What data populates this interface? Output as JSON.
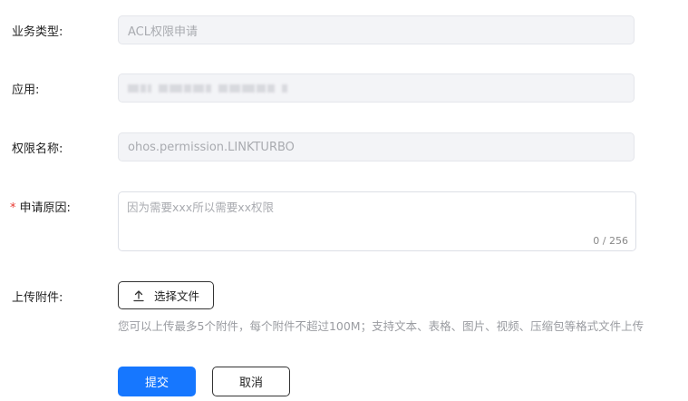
{
  "form": {
    "business_type": {
      "label": "业务类型:",
      "value": "ACL权限申请"
    },
    "application": {
      "label": "应用:"
    },
    "permission_name": {
      "label": "权限名称:",
      "value": "ohos.permission.LINKTURBO"
    },
    "reason": {
      "required_mark": "*",
      "label": "申请原因:",
      "placeholder": "因为需要xxx所以需要xx权限",
      "count": "0 / 256"
    },
    "attachment": {
      "label": "上传附件:",
      "button": "选择文件",
      "hint": "您可以上传最多5个附件，每个附件不超过100M；支持文本、表格、图片、视频、压缩包等格式文件上传"
    }
  },
  "actions": {
    "submit": "提交",
    "cancel": "取消"
  },
  "colors": {
    "primary": "#1677ff",
    "required": "#e8372f"
  }
}
